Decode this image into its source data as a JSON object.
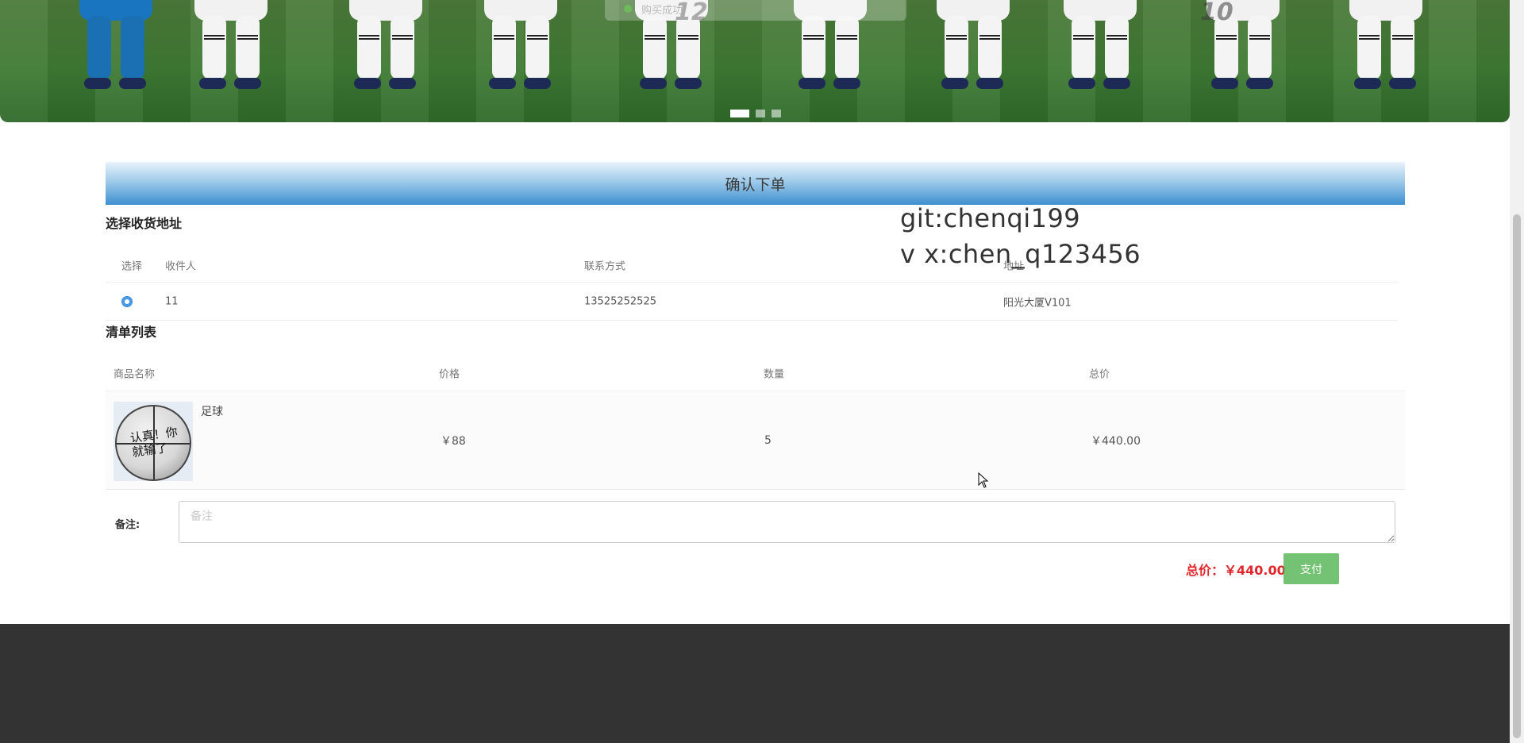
{
  "banner": {
    "toast_text": "购买成功",
    "shirt_numbers": [
      "12",
      "10"
    ],
    "slide_count": 3,
    "active_slide": 1
  },
  "order": {
    "title": "确认下单",
    "address_section": {
      "title": "选择收货地址",
      "columns": [
        "选择",
        "收件人",
        "联系方式",
        "地址"
      ],
      "rows": [
        {
          "selected": true,
          "recipient": "11",
          "phone": "13525252525",
          "address": "阳光大厦V101"
        }
      ]
    },
    "list_section": {
      "title": "清单列表",
      "columns": [
        "商品名称",
        "价格",
        "数量",
        "总价"
      ],
      "items": [
        {
          "name": "足球",
          "image_icon": "basketball-photo",
          "image_text": "认真！你就输了",
          "price": "￥88",
          "quantity": "5",
          "subtotal": "￥440.00"
        }
      ]
    },
    "remark": {
      "label": "备注:",
      "placeholder": "备注",
      "value": ""
    },
    "total_text": "总价：￥440.00",
    "pay_label": "支付"
  },
  "watermark": {
    "line1": "git:chenqi199",
    "line2": "v x:chen_q123456"
  },
  "colors": {
    "header_blue": "#3d8fd0",
    "total_red": "#e0262b",
    "pay_green": "#5cb85c",
    "footer": "#333333"
  }
}
